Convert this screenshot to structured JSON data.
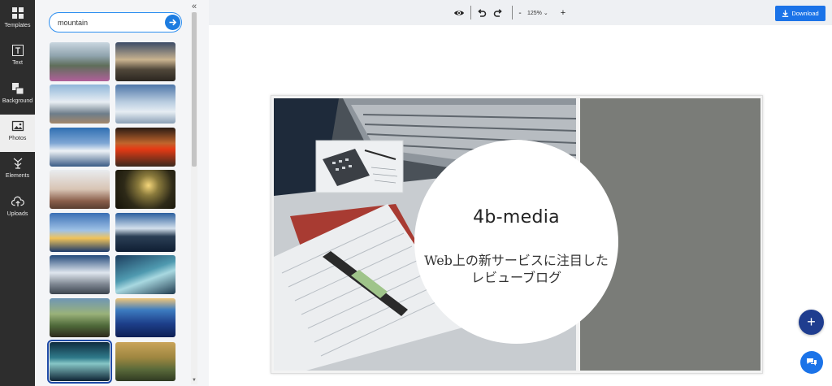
{
  "sidebar": {
    "items": [
      {
        "label": "Templates",
        "icon": "templates-icon"
      },
      {
        "label": "Text",
        "icon": "text-icon"
      },
      {
        "label": "Background",
        "icon": "background-icon"
      },
      {
        "label": "Photos",
        "icon": "photos-icon",
        "active": true
      },
      {
        "label": "Elements",
        "icon": "elements-icon"
      },
      {
        "label": "Uploads",
        "icon": "uploads-icon"
      }
    ]
  },
  "search": {
    "value": "mountain"
  },
  "toolbar": {
    "zoom": "125%",
    "zoom_out": "-",
    "zoom_in": "+",
    "download_label": "Download"
  },
  "canvas": {
    "brand": "4b-media",
    "tagline": "Web上の新サービスに注目した\nレビューブログ"
  },
  "fab": {
    "add": "+"
  },
  "colors": {
    "accent": "#1b73e8",
    "fab_dark": "#1f3d8f",
    "sidebar_bg": "#2d2d2d",
    "canvas_gray": "#7a7c78"
  }
}
